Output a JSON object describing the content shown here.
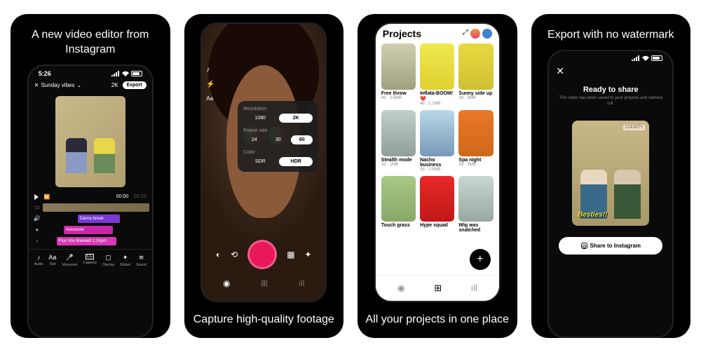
{
  "panels": {
    "editor": {
      "headline": "A new video editor from Instagram",
      "time": "5:26",
      "project_name": "Sunday vibes",
      "quality": "2K",
      "export": "Export",
      "playhead_time": "00:00",
      "duration": "01:27",
      "clips": {
        "dance": "Dance break",
        "voiceover": "Voiceover",
        "flux": "Flux Vox Maxwell 1:24pm"
      },
      "toolbar": [
        {
          "icon": "♪",
          "label": "Audio"
        },
        {
          "icon": "Aa",
          "label": "Text"
        },
        {
          "icon": "🎤",
          "label": "Voiceover"
        },
        {
          "icon": "CC",
          "label": "Captions"
        },
        {
          "icon": "▢",
          "label": "Overlay"
        },
        {
          "icon": "✦",
          "label": "Sticker"
        },
        {
          "icon": "≋",
          "label": "Sound"
        }
      ]
    },
    "camera": {
      "caption": "Capture high-quality footage",
      "settings": {
        "resolution": {
          "label": "Resolution",
          "options": [
            "1080",
            "2K"
          ],
          "selected": "2K"
        },
        "framerate": {
          "label": "Frame rate",
          "options": [
            "24",
            "30",
            "60"
          ],
          "selected": "60"
        },
        "color": {
          "label": "Color",
          "options": [
            "SDR",
            "HDR"
          ],
          "selected": "HDR"
        }
      }
    },
    "projects": {
      "caption": "All your projects in one place",
      "title": "Projects",
      "items": [
        {
          "title": "Free throw",
          "meta": "4d · 2.5MB"
        },
        {
          "title": "Inflata-BOOM! ❤️",
          "meta": "4d · 1.1MB"
        },
        {
          "title": "Sunny side up",
          "meta": "3d · 2MB"
        },
        {
          "title": "Stealth mode",
          "meta": "1d · 1MB"
        },
        {
          "title": "Nacho business",
          "meta": "3d · 2.5MB"
        },
        {
          "title": "Spa night",
          "meta": "2d · 3MB"
        },
        {
          "title": "Touch grass",
          "meta": ""
        },
        {
          "title": "Hype squad",
          "meta": ""
        },
        {
          "title": "Wig was snatched",
          "meta": ""
        }
      ]
    },
    "export": {
      "headline": "Export with no watermark",
      "title": "Ready to share",
      "subtitle": "This video has been saved to your projects and camera roll.",
      "county": "COUNTY",
      "besties": "Besties!!",
      "share": "Share to Instagram"
    }
  }
}
